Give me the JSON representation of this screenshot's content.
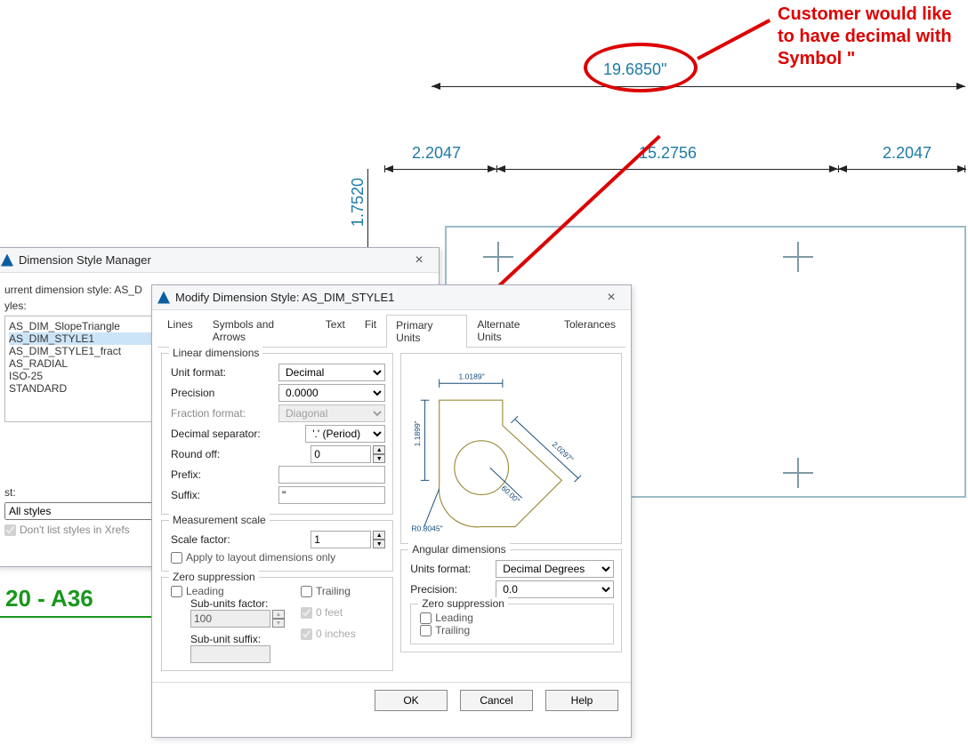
{
  "annotation": {
    "text": "Customer would like to have decimal with Symbol \""
  },
  "dims": {
    "top": "19.6850\"",
    "left": "2.2047",
    "mid": "15.2756",
    "right": "2.2047",
    "vert": "1.7520"
  },
  "profile": "20 - A36",
  "dsm": {
    "title": "Dimension Style Manager",
    "current_label": "urrent dimension style: AS_D",
    "styles_label": "yles:",
    "styles": [
      "AS_DIM_SlopeTriangle",
      "AS_DIM_STYLE1",
      "AS_DIM_STYLE1_fract",
      "AS_RADIAL",
      "ISO-25",
      "STANDARD"
    ],
    "selected_style": "AS_DIM_STYLE1",
    "list_label": "st:",
    "filter": "All styles",
    "xref_label": "Don't list styles in Xrefs"
  },
  "mdlg": {
    "title": "Modify Dimension Style: AS_DIM_STYLE1",
    "tabs": [
      "Lines",
      "Symbols and Arrows",
      "Text",
      "Fit",
      "Primary Units",
      "Alternate Units",
      "Tolerances"
    ],
    "active_tab": "Primary Units",
    "linear": {
      "group": "Linear dimensions",
      "unit_format_label": "Unit format:",
      "unit_format": "Decimal",
      "precision_label": "Precision",
      "precision": "0.0000",
      "fraction_format_label": "Fraction format:",
      "fraction_format": "Diagonal",
      "decimal_sep_label": "Decimal separator:",
      "decimal_sep": "'.' (Period)",
      "roundoff_label": "Round off:",
      "roundoff": "0",
      "prefix_label": "Prefix:",
      "prefix": "",
      "suffix_label": "Suffix:",
      "suffix": "\""
    },
    "meas": {
      "group": "Measurement scale",
      "scale_label": "Scale factor:",
      "scale": "1",
      "layout_label": "Apply to layout dimensions only"
    },
    "zero": {
      "group": "Zero suppression",
      "leading": "Leading",
      "trailing": "Trailing",
      "subfactor_label": "Sub-units factor:",
      "subfactor": "100",
      "subsuffix_label": "Sub-unit suffix:",
      "subsuffix": "",
      "feet": "0 feet",
      "inches": "0 inches"
    },
    "angular": {
      "group": "Angular dimensions",
      "format_label": "Units format:",
      "format": "Decimal Degrees",
      "precision_label": "Precision:",
      "precision": "0.0",
      "zero_group": "Zero suppression",
      "leading": "Leading",
      "trailing": "Trailing"
    },
    "preview": {
      "top": "1.0189\"",
      "left": "1.1899\"",
      "rightdiag": "2.0297\"",
      "angle": "60.00°",
      "radius": "R0.8045\""
    },
    "buttons": {
      "ok": "OK",
      "cancel": "Cancel",
      "help": "Help"
    }
  }
}
